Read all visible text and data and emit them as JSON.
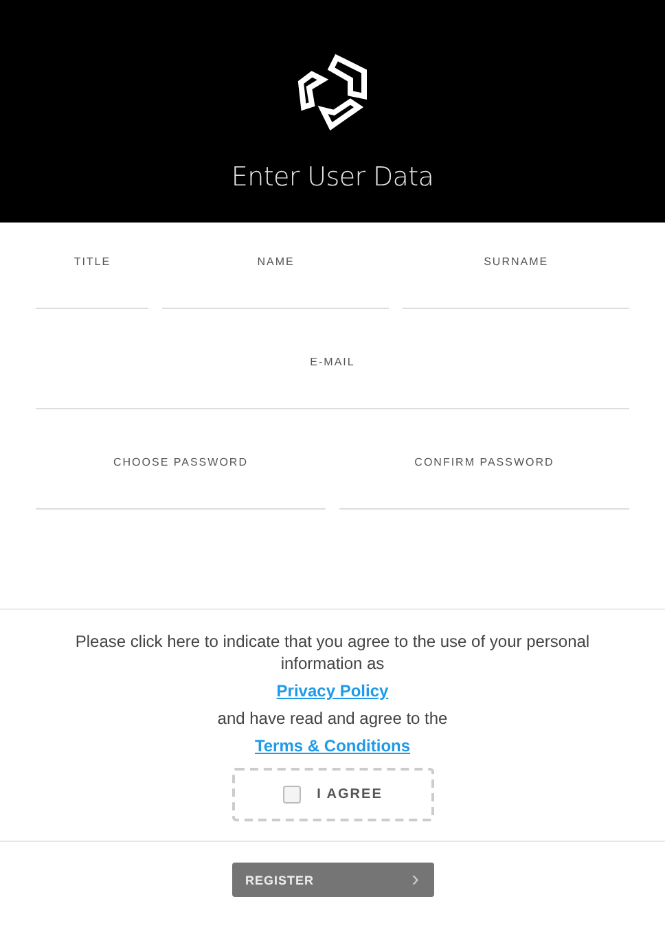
{
  "header": {
    "title": "Enter User Data"
  },
  "form": {
    "fields": [
      {
        "label": "TITLE"
      },
      {
        "label": "NAME"
      },
      {
        "label": "SURNAME"
      },
      {
        "label": "E-MAIL"
      },
      {
        "label": "CHOOSE PASSWORD"
      },
      {
        "label": "CONFIRM PASSWORD"
      }
    ]
  },
  "consent": {
    "intro": "Please click here to indicate that you agree to the use of your personal information as",
    "privacy_link": "Privacy Policy",
    "middle": "and have read and agree to the",
    "terms_link": "Terms & Conditions",
    "agree": {
      "label": "I AGREE",
      "checked": false
    }
  },
  "register_button": {
    "label": "REGISTER",
    "arrow": "›"
  }
}
